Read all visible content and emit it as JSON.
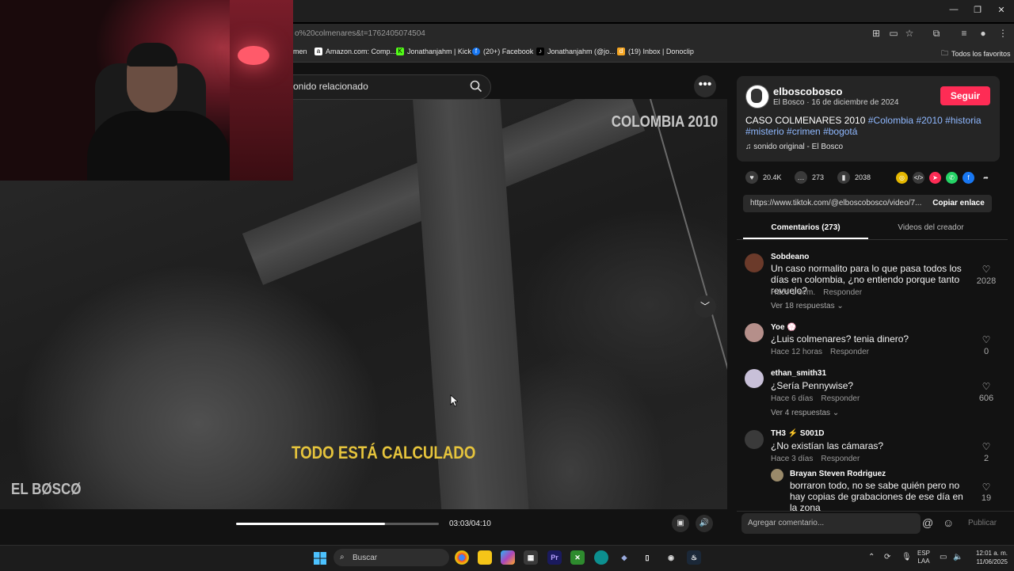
{
  "browser": {
    "url": "o%20colmenares&t=1762405074504",
    "window_controls": [
      "—",
      "❐",
      "✕"
    ],
    "bookmarks": [
      {
        "label": "men",
        "icon": "none"
      },
      {
        "label": "Amazon.com: Comp...",
        "icon": "amazon-icon"
      },
      {
        "label": "Jonathanjahm | Kick",
        "icon": "kick-icon"
      },
      {
        "label": "(20+) Facebook",
        "icon": "facebook-icon"
      },
      {
        "label": "Jonathanjahm (@jo...",
        "icon": "tiktok-icon"
      },
      {
        "label": "(19) Inbox | Donoclip",
        "icon": "donoclip-icon"
      }
    ],
    "all_favorites": "Todos los favoritos"
  },
  "search": {
    "text": "onido relacionado"
  },
  "video": {
    "overlay_tag": "COLOMBIA 2010",
    "caption": "TODO ESTÁ CALCULADO",
    "watermark": "EL BØSCØ",
    "time": "03:03/04:10",
    "progress": 0.735
  },
  "creator": {
    "username": "elboscobosco",
    "subtitle": "El Bosco · 16 de diciembre de 2024",
    "follow_label": "Seguir",
    "desc_text": "CASO COLMENARES 2010",
    "desc_tags": [
      "#Colombia",
      "#2010",
      "#historia",
      "#misterio",
      "#crimen",
      "#bogotá"
    ],
    "sound": "sonido original - El Bosco"
  },
  "actions": {
    "likes": "20.4K",
    "comments": "273",
    "saves": "2038"
  },
  "share_colors": {
    "embed": "#e5b800",
    "code": "#3a3a3a",
    "send": "#fe2c55",
    "whatsapp": "#25d366",
    "facebook": "#1877f2"
  },
  "link": {
    "url": "https://www.tiktok.com/@elboscobosco/video/7...",
    "copy_label": "Copiar enlace"
  },
  "tabs": {
    "comments": "Comentarios (273)",
    "videos": "Videos del creador"
  },
  "comments": [
    {
      "user": "Sobdeano",
      "text": "Un caso normalito para lo que pasa todos los días en colombia, ¿no entiendo porque tanto revuelo?",
      "time": "Hace 1 sem.",
      "reply": "Responder",
      "likes": "2028",
      "more": "Ver 18 respuestas",
      "avatar_color": "#6b3a2a"
    },
    {
      "user": "Yoe 💮",
      "text": "¿Luis colmenares? tenia dinero?",
      "time": "Hace 12 horas",
      "reply": "Responder",
      "likes": "0",
      "more": "",
      "avatar_color": "#b58f8a"
    },
    {
      "user": "ethan_smith31",
      "text": "¿Sería Pennywise?",
      "time": "Hace 6 días",
      "reply": "Responder",
      "likes": "606",
      "more": "Ver 4 respuestas",
      "avatar_color": "#c8c0d8"
    },
    {
      "user": "TH3 ⚡ S001D",
      "text": "¿No existían las cámaras?",
      "time": "Hace 3 días",
      "reply": "Responder",
      "likes": "2",
      "more": "",
      "avatar_color": "#3a3a3a"
    }
  ],
  "reply": {
    "user": "Brayan Steven Rodriguez",
    "text": "borraron todo, no se sabe quién pero no hay copias de grabaciones de ese día en la zona",
    "likes": "19",
    "avatar_color": "#9a8a6a"
  },
  "comment_box": {
    "placeholder": "Agregar comentario...",
    "publish": "Publicar"
  },
  "taskbar": {
    "search": "Buscar",
    "lang_top": "ESP",
    "lang_bottom": "LAA",
    "time": "12:01 a. m.",
    "date": "11/06/2025"
  }
}
